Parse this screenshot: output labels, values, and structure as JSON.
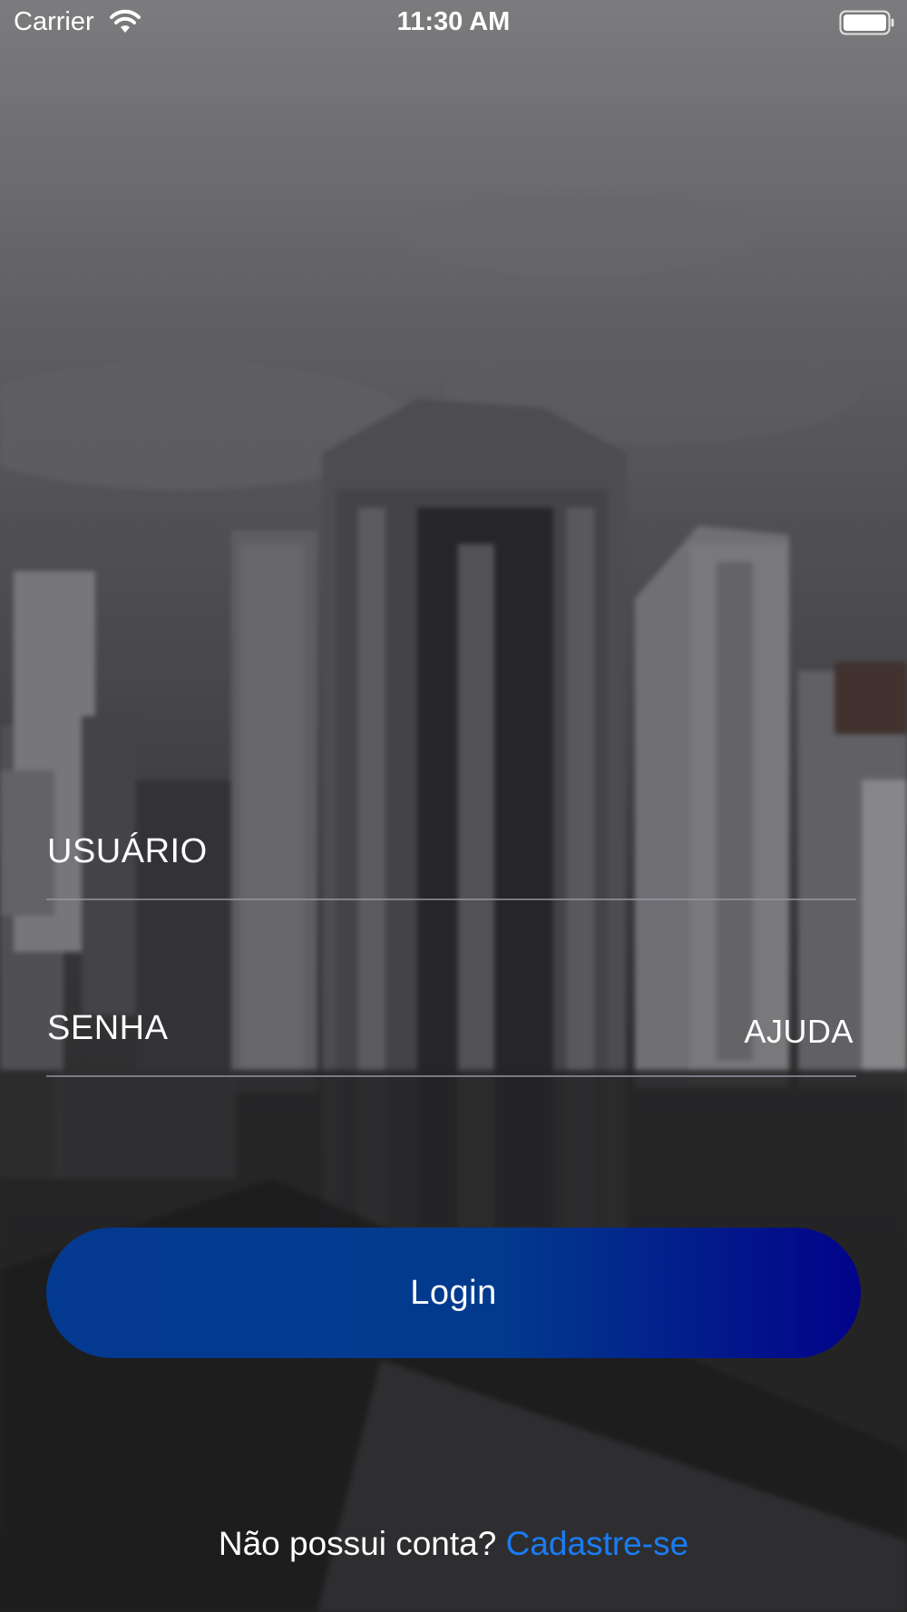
{
  "status_bar": {
    "carrier": "Carrier",
    "time": "11:30 AM",
    "icons": [
      "wifi-icon",
      "battery-icon"
    ]
  },
  "form": {
    "username_placeholder": "USUÁRIO",
    "password_placeholder": "SENHA",
    "help_label": "AJUDA",
    "login_label": "Login"
  },
  "signup": {
    "prompt": "Não possui conta?",
    "link_label": "Cadastre-se"
  },
  "colors": {
    "login_gradient_start": "#033a90",
    "login_gradient_end": "#02038a",
    "link": "#1a7cf2",
    "text": "#ffffff",
    "divider": "#96969f"
  }
}
